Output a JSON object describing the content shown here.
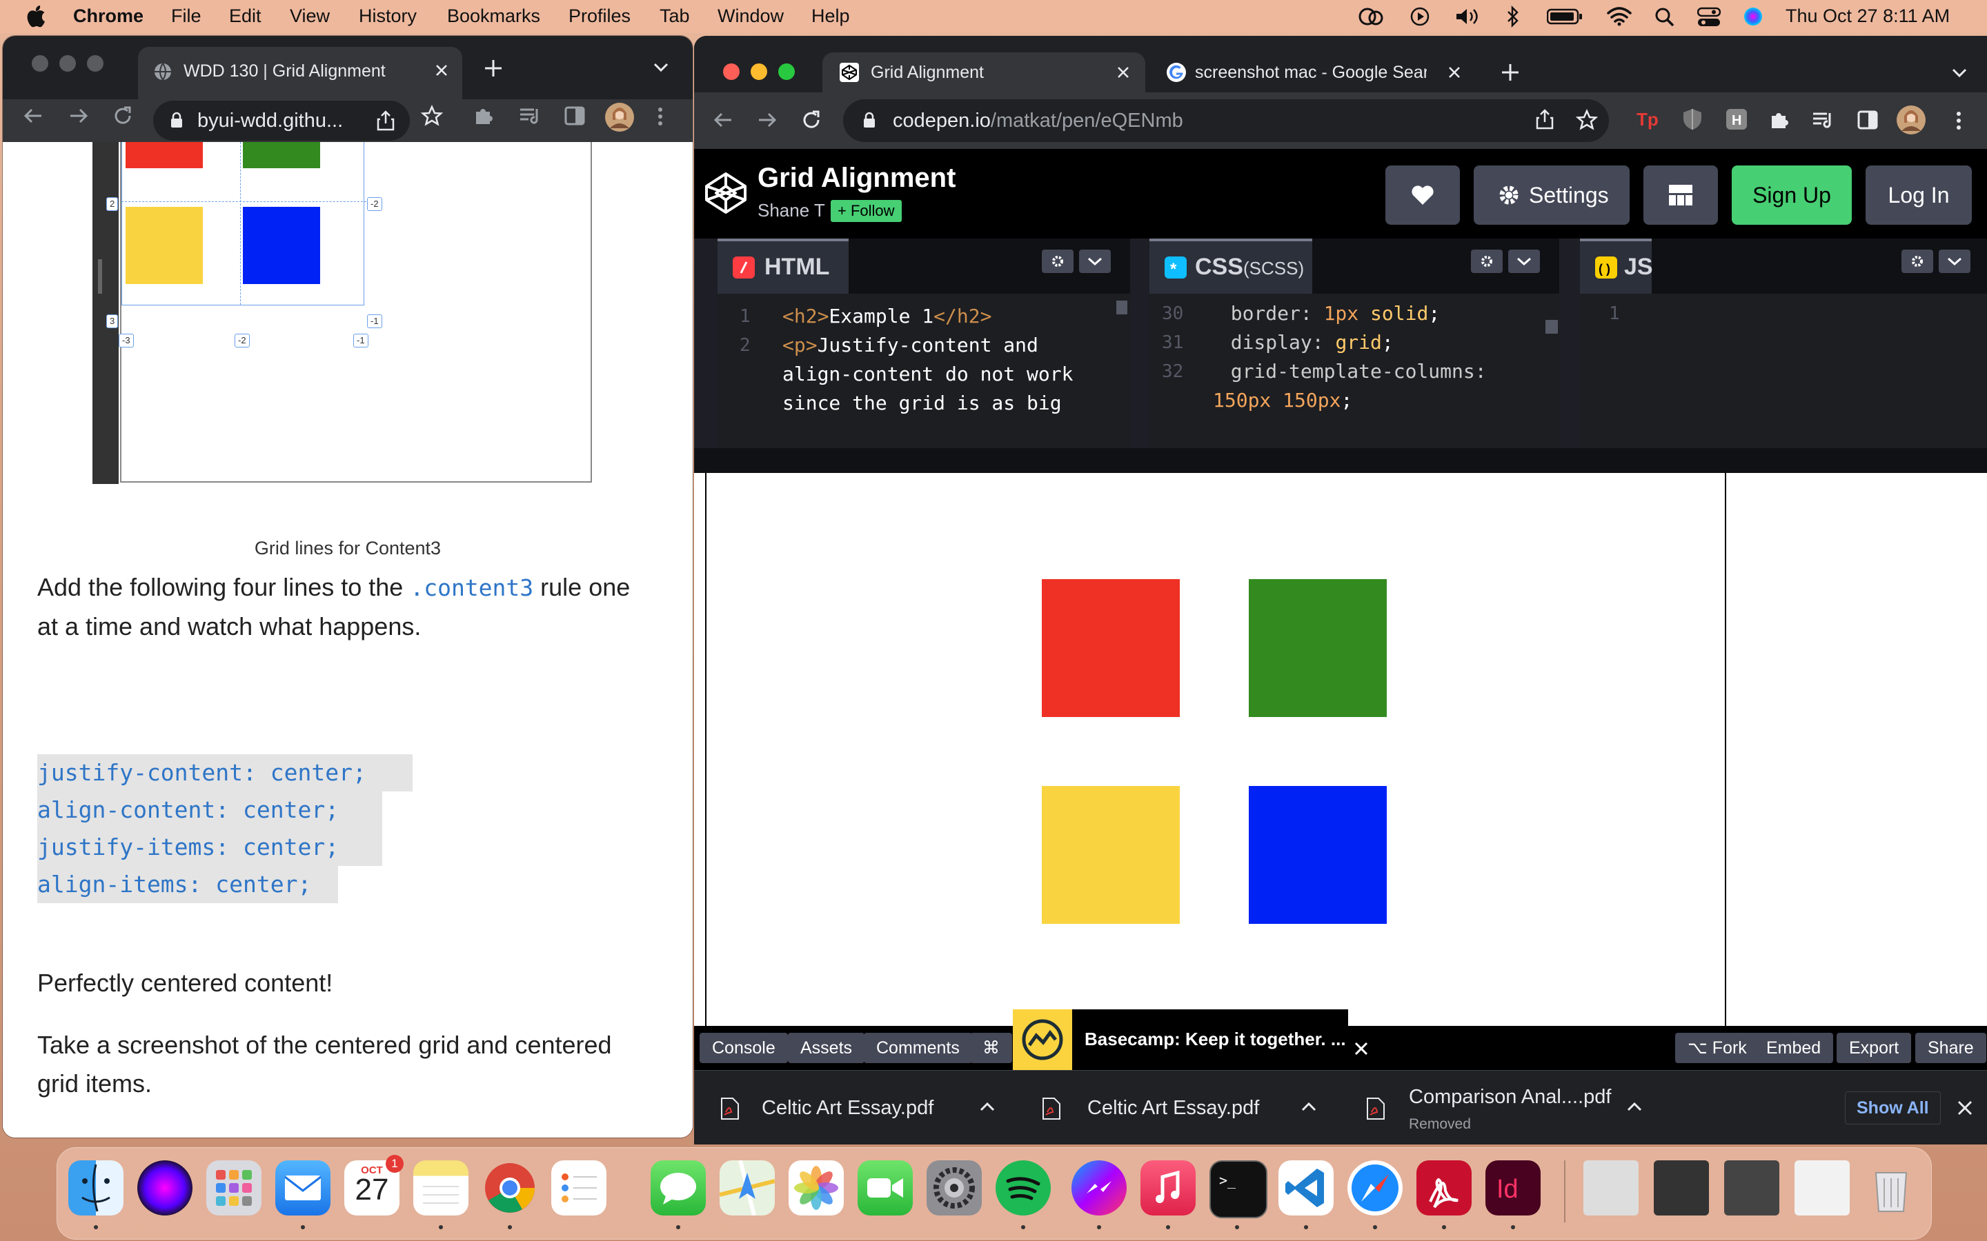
{
  "menubar": {
    "app": "Chrome",
    "items": [
      "File",
      "Edit",
      "View",
      "History",
      "Bookmarks",
      "Profiles",
      "Tab",
      "Window",
      "Help"
    ],
    "clock": "Thu Oct 27  8:11 AM"
  },
  "left_window": {
    "tab_title": "WDD 130 | Grid Alignment",
    "url": "byui-wdd.githu...",
    "diagram_caption": "Grid lines for Content3",
    "grid_line_numbers": [
      "2",
      "-2",
      "3",
      "-1",
      "-3",
      "-2",
      "-1"
    ],
    "para1_before": "Add the following four lines to the ",
    "para1_code": ".content3",
    "para1_after": " rule one at a time and watch what happens.",
    "code_lines": [
      "justify-content: center;",
      "align-content: center;",
      "justify-items: center;",
      "align-items: center;"
    ],
    "para2": "Perfectly centered content!",
    "para3": "Take a screenshot of the centered grid and centered grid items."
  },
  "right_window": {
    "tabs": [
      {
        "label": "Grid Alignment"
      },
      {
        "label": "screenshot mac - Google Search"
      }
    ],
    "url_host": "codepen.io",
    "url_path": "/matkat/pen/eQENmb",
    "codepen": {
      "title": "Grid Alignment",
      "author": "Shane T",
      "follow": "+ Follow",
      "settings": "Settings",
      "signup": "Sign Up",
      "login": "Log In",
      "html_tab": "HTML",
      "css_tab": "CSS",
      "css_sub": "(SCSS)",
      "js_tab": "JS",
      "html_lines": [
        {
          "n": "1",
          "text": "<h2>Example 1</h2>"
        },
        {
          "n": "2",
          "text": "<p>Justify-content and"
        },
        {
          "n": "",
          "text": "align-content do not work"
        },
        {
          "n": "",
          "text": "since the grid is as big"
        }
      ],
      "css_lines": [
        {
          "n": "30",
          "text": "  border: 1px solid;"
        },
        {
          "n": "31",
          "text": "  display: grid;"
        },
        {
          "n": "32",
          "text": "  grid-template-columns:"
        },
        {
          "n": "",
          "text": "150px 150px;"
        }
      ],
      "js_lines": [
        {
          "n": "1",
          "text": ""
        }
      ],
      "footer_left": [
        "Console",
        "Assets",
        "Comments",
        "⌘"
      ],
      "footer_right": [
        "Fork",
        "Embed",
        "Export",
        "Share"
      ],
      "ad_text": "Basecamp: Keep it together. ..."
    },
    "downloads": [
      {
        "name": "Celtic Art Essay.pdf",
        "status": ""
      },
      {
        "name": "Celtic Art Essay.pdf",
        "status": ""
      },
      {
        "name": "Comparison Anal....pdf",
        "status": "Removed"
      }
    ],
    "show_all": "Show All"
  },
  "dock": {
    "calendar_month": "OCT",
    "calendar_day": "27",
    "calendar_badge": "1"
  },
  "colors": {
    "red": "#ee3124",
    "green": "#338a1f",
    "yellow": "#f9d440",
    "blue": "#0022f5",
    "codepen_green": "#47cf73",
    "code_blue": "#2e75c7"
  }
}
